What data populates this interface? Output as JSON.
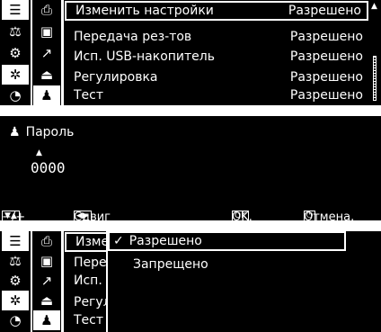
{
  "screen_settings": {
    "icons": [
      "list-icon",
      "print-icon",
      "balance-icon",
      "save-icon",
      "weight-setup-icon",
      "graph-icon",
      "gear-icon",
      "device-icon",
      "timer-icon",
      "user-icon"
    ],
    "rows": [
      {
        "label": "Изменить настройки",
        "value": "Разрешено"
      },
      {
        "label": "Передача рез-тов",
        "value": "Разрешено"
      },
      {
        "label": "Исп. USB-накопитель",
        "value": "Разрешено"
      },
      {
        "label": "Регулировка",
        "value": "Разрешено"
      },
      {
        "label": "Тест",
        "value": "Разрешено"
      }
    ]
  },
  "screen_password": {
    "title": "Пароль",
    "value": "0000",
    "footer": {
      "increment": "−/+",
      "shift": "Сдвиг",
      "ok_key": "OK",
      "ok_label": "OK.",
      "cancel_label": "Отмена."
    }
  },
  "screen_dropdown": {
    "rows_truncated": [
      "Измен",
      "Перед",
      "Исп.",
      "Регул",
      "Тест"
    ],
    "options": [
      {
        "label": "Разрешено",
        "selected": true,
        "check": "✓"
      },
      {
        "label": "Запрещено",
        "selected": false
      }
    ]
  }
}
